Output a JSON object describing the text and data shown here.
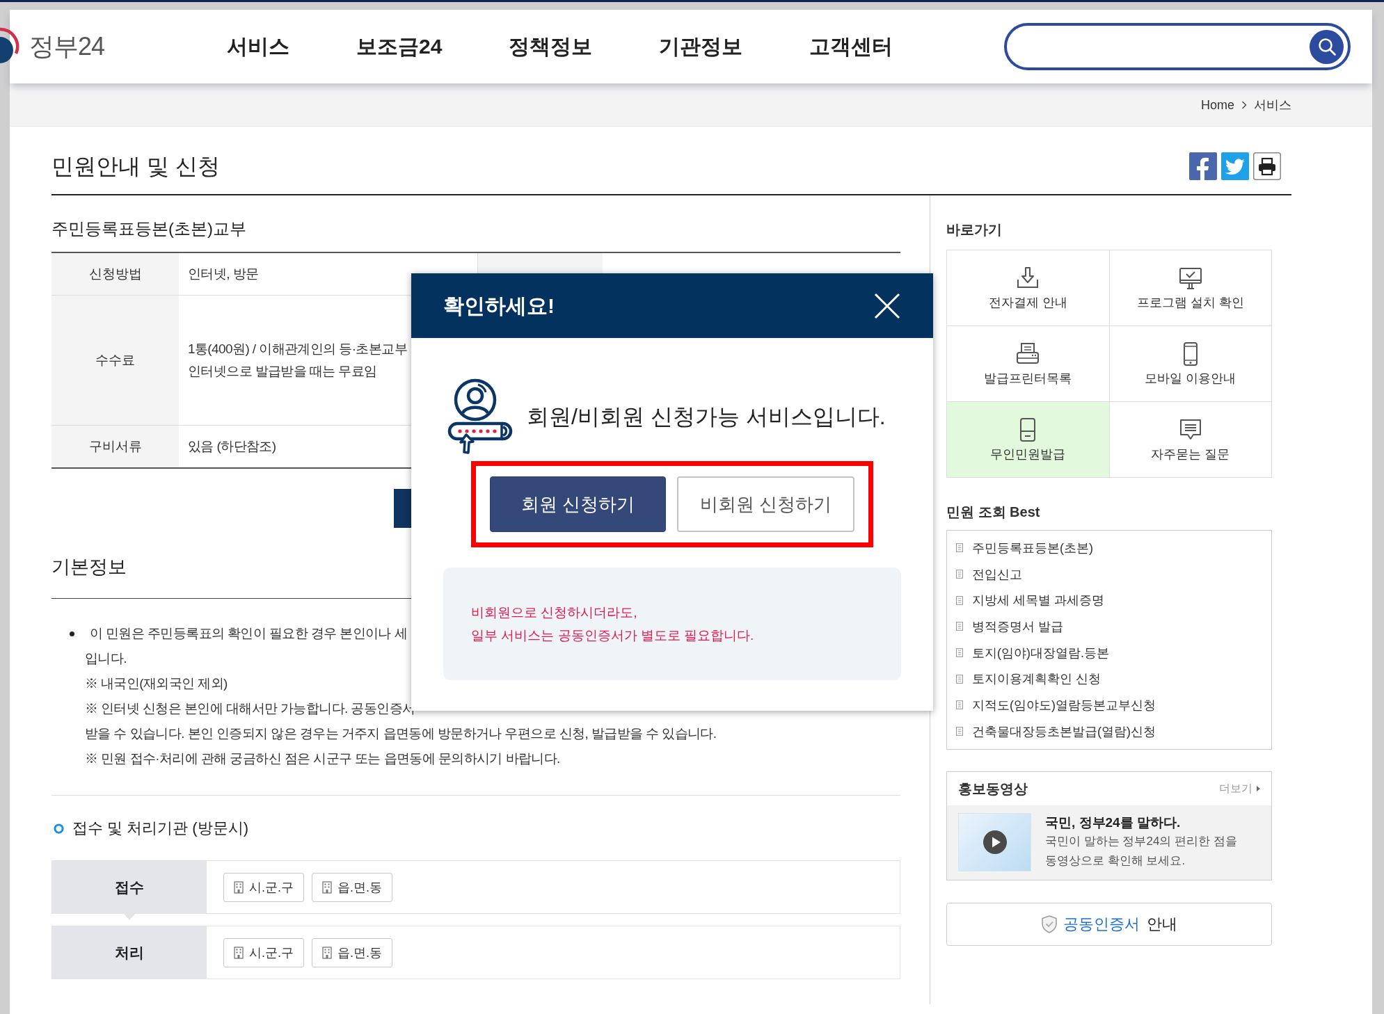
{
  "header": {
    "logo_text": "정부24",
    "nav": [
      "서비스",
      "보조금24",
      "정책정보",
      "기관정보",
      "고객센터"
    ]
  },
  "breadcrumb": [
    "Home",
    "서비스"
  ],
  "page_title": "민원안내 및 신청",
  "service": {
    "title": "주민등록표등본(초본)교부",
    "rows": [
      {
        "cells": [
          {
            "kind": "label",
            "text": "신청방법"
          },
          {
            "kind": "value",
            "lines": [
              "인터넷, 방문"
            ]
          },
          {
            "kind": "label"
          },
          {
            "kind": "value"
          }
        ]
      },
      {
        "cells": [
          {
            "kind": "label",
            "text": "수수료"
          },
          {
            "kind": "value",
            "lines": [
              "1통(400원) / 이해관계인의 등·초본교부",
              "인터넷으로 발급받을 때는 무료임"
            ]
          }
        ]
      },
      {
        "cells": [
          {
            "kind": "label",
            "text": "구비서류"
          },
          {
            "kind": "value",
            "lines": [
              "있음 (하단참조)"
            ]
          }
        ]
      }
    ]
  },
  "basic_info": {
    "title": "기본정보",
    "bullet": "이 민원은 주민등록표의 확인이 필요한 경우 본인이나 세",
    "lines": [
      "입니다.",
      "※ 내국인(재외국인 제외)",
      "※ 인터넷 신청은 본인에 대해서만 가능합니다. 공동인증서",
      "받을 수 있습니다. 본인 인증되지 않은 경우는 거주지 읍면동에 방문하거나 우편으로 신청, 발급받을 수 있습니다.",
      "※ 민원 접수·처리에 관해 궁금하신 점은 시군구 또는 읍면동에 문의하시기 바랍니다."
    ]
  },
  "offices": {
    "title": "접수 및 처리기관 (방문시)",
    "rows": [
      {
        "label": "접수",
        "options": [
          "시.군.구",
          "읍.면.동"
        ]
      },
      {
        "label": "처리",
        "options": [
          "시.군.구",
          "읍.면.동"
        ]
      }
    ]
  },
  "quick_links": {
    "title": "바로가기",
    "items": [
      {
        "kind": "download",
        "label": "전자결제 안내",
        "highlighted": false
      },
      {
        "kind": "monitor",
        "label": "프로그램 설치 확인",
        "highlighted": false
      },
      {
        "kind": "printer",
        "label": "발급프린터목록",
        "highlighted": false
      },
      {
        "kind": "phone",
        "label": "모바일 이용안내",
        "highlighted": false
      },
      {
        "kind": "kiosk",
        "label": "무인민원발급",
        "highlighted": true
      },
      {
        "kind": "chat",
        "label": "자주묻는 질문",
        "highlighted": false
      }
    ]
  },
  "best": {
    "title": "민원 조회 Best",
    "items": [
      "주민등록표등본(초본)",
      "전입신고",
      "지방세 세목별 과세증명",
      "병적증명서 발급",
      "토지(임야)대장열람.등본",
      "토지이용계획확인 신청",
      "지적도(임야도)열람등본교부신청",
      "건축물대장등초본발급(열람)신청"
    ]
  },
  "video": {
    "title": "홍보동영상",
    "more": "더보기",
    "headline": "국민, 정부24를 말하다.",
    "description": "국민이 말하는 정부24의 편리한 점을 동영상으로 확인해 보세요."
  },
  "cert_button": {
    "highlight": "공동인증서",
    "rest": "안내"
  },
  "dialog": {
    "title": "확인하세요!",
    "message": "회원/비회원 신청가능 서비스입니다.",
    "button_frame": true,
    "buttons": [
      {
        "kind": "primary",
        "label": "회원 신청하기"
      },
      {
        "kind": "secondary",
        "label": "비회원 신청하기"
      }
    ],
    "notice": "비회원으로 신청하시더라도,\n일부 서비스는 공동인증서가 별도로 필요합니다."
  }
}
